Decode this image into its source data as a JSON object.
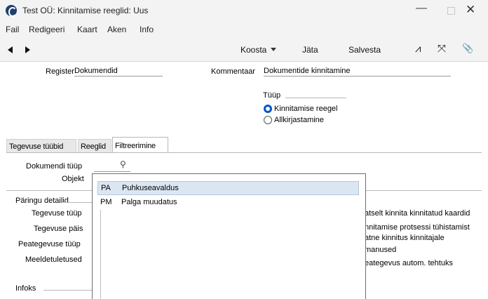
{
  "window": {
    "title": "Test OÜ: Kinnitamise reeglid: Uus",
    "minimize": "—",
    "close": "✕"
  },
  "menu": [
    "Fail",
    "Redigeeri",
    "Kaart",
    "Aken",
    "Info"
  ],
  "toolbar": {
    "koosta": "Koosta",
    "jata": "Jäta",
    "salvesta": "Salvesta",
    "icons": {
      "activity": "⩘",
      "expand": "⤧",
      "attach": "📎"
    }
  },
  "form": {
    "register_label": "Register",
    "register_value": "Dokumendid",
    "kommentaar_label": "Kommentaar",
    "kommentaar_value": "Dokumentide kinnitamine",
    "tyyp_label": "Tüüp",
    "radio_options": [
      {
        "label": "Kinnitamise reegel",
        "selected": true
      },
      {
        "label": "Allkirjastamine",
        "selected": false
      }
    ]
  },
  "tabs": [
    {
      "label": "Tegevuse tüübid",
      "active": false
    },
    {
      "label": "Reeglid",
      "active": false
    },
    {
      "label": "Filtreerimine",
      "active": true
    }
  ],
  "filter": {
    "dokumendi_tyyp_label": "Dokumendi tüüp",
    "objekt_label": "Objekt"
  },
  "paringu": {
    "section_label": "Päringu detailid",
    "rows": [
      "Tegevuse tüüp",
      "Tegevuse päis",
      "Peategevuse tüüp",
      "Meeldetuletused"
    ],
    "infoks_label": "Infoks"
  },
  "right_checks": [
    "atselt kinnita kinnitatud kaardid",
    "nnitamise protsessi tühistamist",
    "atne kinnitus kinnitajale",
    "manused",
    "eategevus autom. tehtuks"
  ],
  "popup": {
    "items": [
      {
        "code": "PA",
        "name": "Puhkuseavaldus",
        "selected": true
      },
      {
        "code": "PM",
        "name": "Palga muudatus",
        "selected": false
      }
    ]
  }
}
